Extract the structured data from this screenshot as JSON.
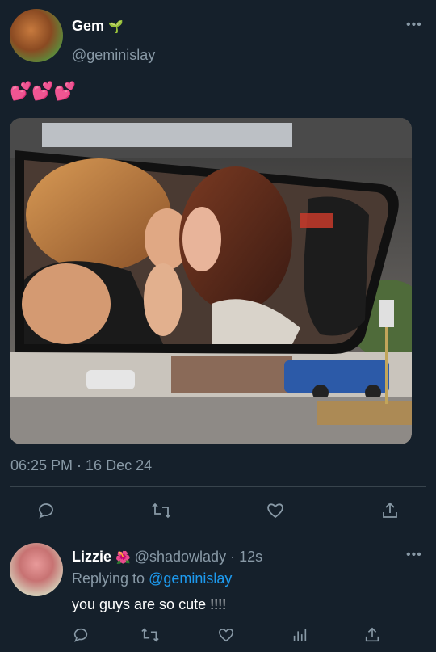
{
  "tweet": {
    "author_name": "Gem",
    "author_emoji": "🌱",
    "author_handle": "@geminislay",
    "body": "💕💕💕",
    "timestamp": "06:25 PM · 16 Dec 24",
    "more_label": "•••"
  },
  "reply": {
    "author_name": "Lizzie",
    "author_emoji": "🌺",
    "author_handle": "@shadowlady",
    "time_ago": "· 12s",
    "replying_to_label": "Replying to",
    "replying_to_handle": "@geminislay",
    "body": "you guys are so cute !!!!",
    "more_label": "•••"
  },
  "icons": [
    "reply-icon",
    "retweet-icon",
    "like-icon",
    "share-icon",
    "analytics-icon"
  ],
  "colors": {
    "background": "#15202b",
    "muted": "#8899a6",
    "link": "#1d9bf0",
    "divider": "#38444d"
  }
}
